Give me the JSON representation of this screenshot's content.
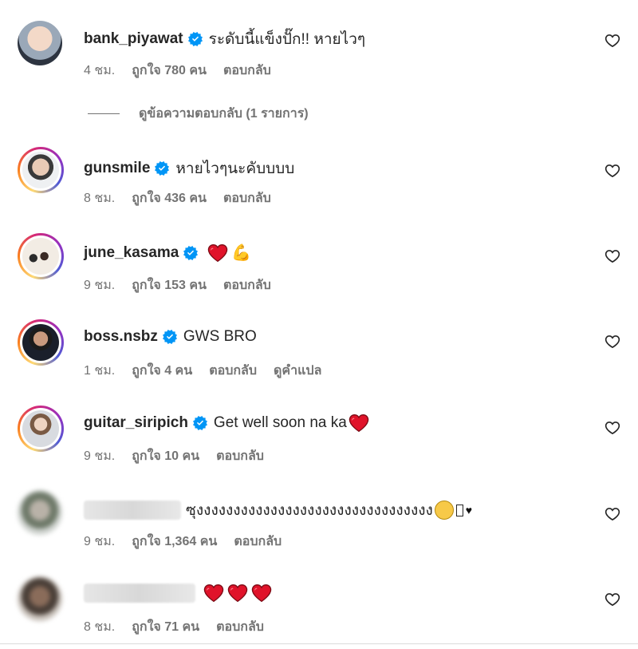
{
  "comments": [
    {
      "username": "bank_piyawat",
      "verified": true,
      "text": "ระดับนี้แข็งปั๊ก!! หายไวๆ",
      "time": "4 ชม.",
      "likes": "ถูกใจ 780 คน",
      "reply": "ตอบกลับ",
      "translate": ""
    },
    {
      "username": "gunsmile",
      "verified": true,
      "text": "หายไวๆนะคับบบบ",
      "time": "8 ชม.",
      "likes": "ถูกใจ 436 คน",
      "reply": "ตอบกลับ",
      "translate": ""
    },
    {
      "username": "june_kasama",
      "verified": true,
      "text": "",
      "time": "9 ชม.",
      "likes": "ถูกใจ 153 คน",
      "reply": "ตอบกลับ",
      "translate": ""
    },
    {
      "username": "boss.nsbz",
      "verified": true,
      "text": "GWS BRO",
      "time": "1 ชม.",
      "likes": "ถูกใจ 4 คน",
      "reply": "ตอบกลับ",
      "translate": "ดูคำแปล"
    },
    {
      "username": "guitar_siripich",
      "verified": true,
      "text": "Get well soon na ka",
      "time": "9 ชม.",
      "likes": "ถูกใจ 10 คน",
      "reply": "ตอบกลับ",
      "translate": ""
    },
    {
      "username": "",
      "verified": false,
      "text": "ซุงงงงงงงงงงงงงงงงงงงงงงงงงงงงงงงง",
      "time": "9 ชม.",
      "likes": "ถูกใจ 1,364 คน",
      "reply": "ตอบกลับ",
      "translate": ""
    },
    {
      "username": "",
      "verified": false,
      "text": "",
      "time": "8 ชม.",
      "likes": "ถูกใจ 71 คน",
      "reply": "ตอบกลับ",
      "translate": ""
    }
  ],
  "view_replies": "ดูข้อความตอบกลับ (1 รายการ)",
  "icons": {
    "verified": "verified-badge-icon",
    "like": "heart-outline-icon"
  },
  "colors": {
    "verified": "#0095f6",
    "meta": "#737373",
    "text": "#262626",
    "heart_red": "#e0132a"
  }
}
